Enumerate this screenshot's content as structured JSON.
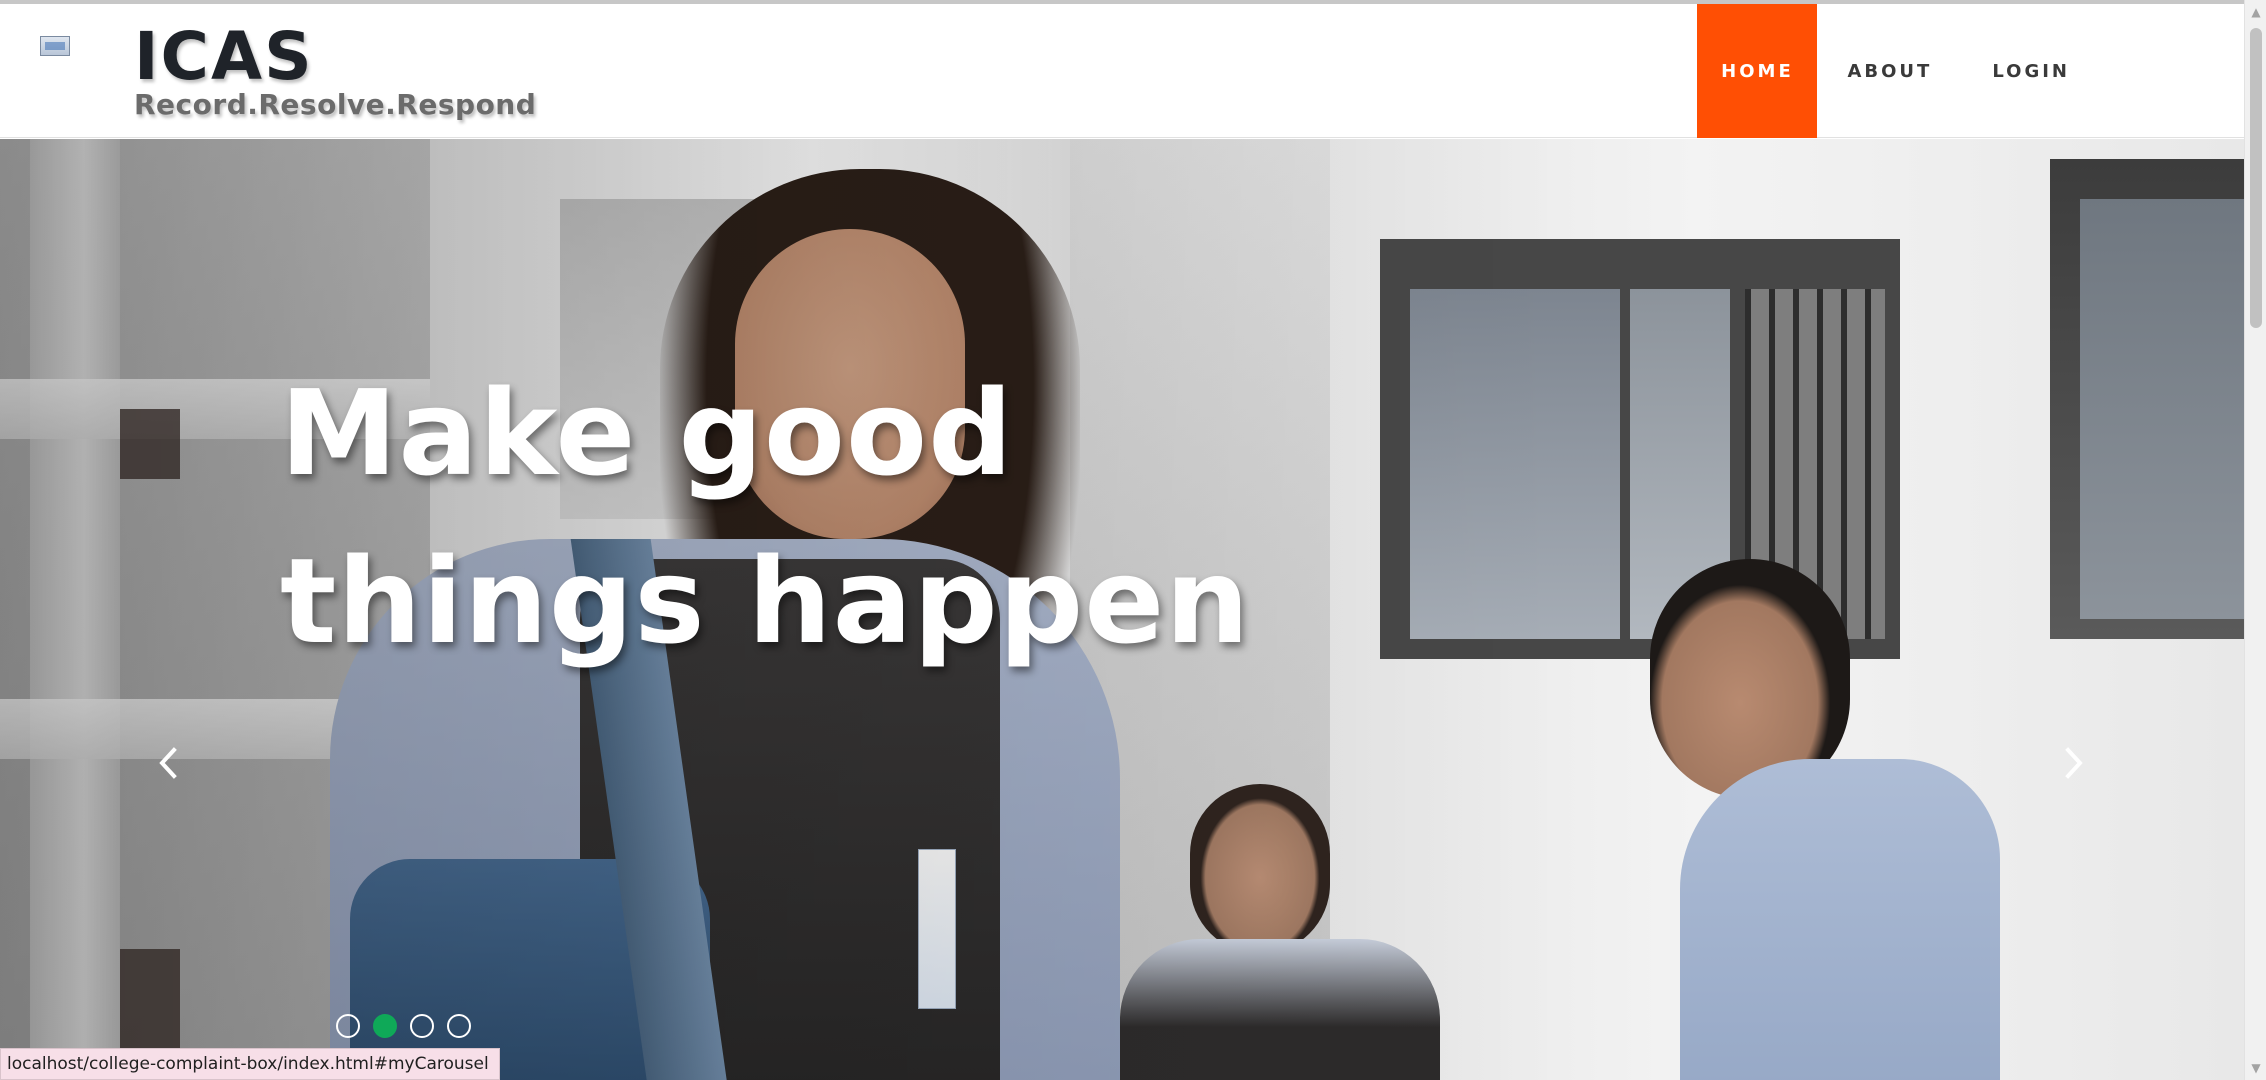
{
  "header": {
    "brand_title": "ICAS",
    "brand_tagline": "Record.Resolve.Respond",
    "logo_icon": "broken-image-icon"
  },
  "nav": {
    "items": [
      {
        "label": "HOME",
        "active": true
      },
      {
        "label": "ABOUT",
        "active": false
      },
      {
        "label": "LOGIN",
        "active": false
      }
    ],
    "active_color": "#ff4f04"
  },
  "carousel": {
    "headline_line1": "Make good",
    "headline_line2": "things happen",
    "prev_icon": "chevron-left-icon",
    "next_icon": "chevron-right-icon",
    "indicators": [
      {
        "active": false
      },
      {
        "active": true
      },
      {
        "active": false
      },
      {
        "active": false
      }
    ],
    "active_indicator_color": "#0fa958"
  },
  "status_bar": {
    "url": "localhost/college-complaint-box/index.html#myCarousel"
  },
  "scrollbar": {
    "up_icon": "scroll-up-arrow-icon",
    "down_icon": "scroll-down-arrow-icon"
  }
}
